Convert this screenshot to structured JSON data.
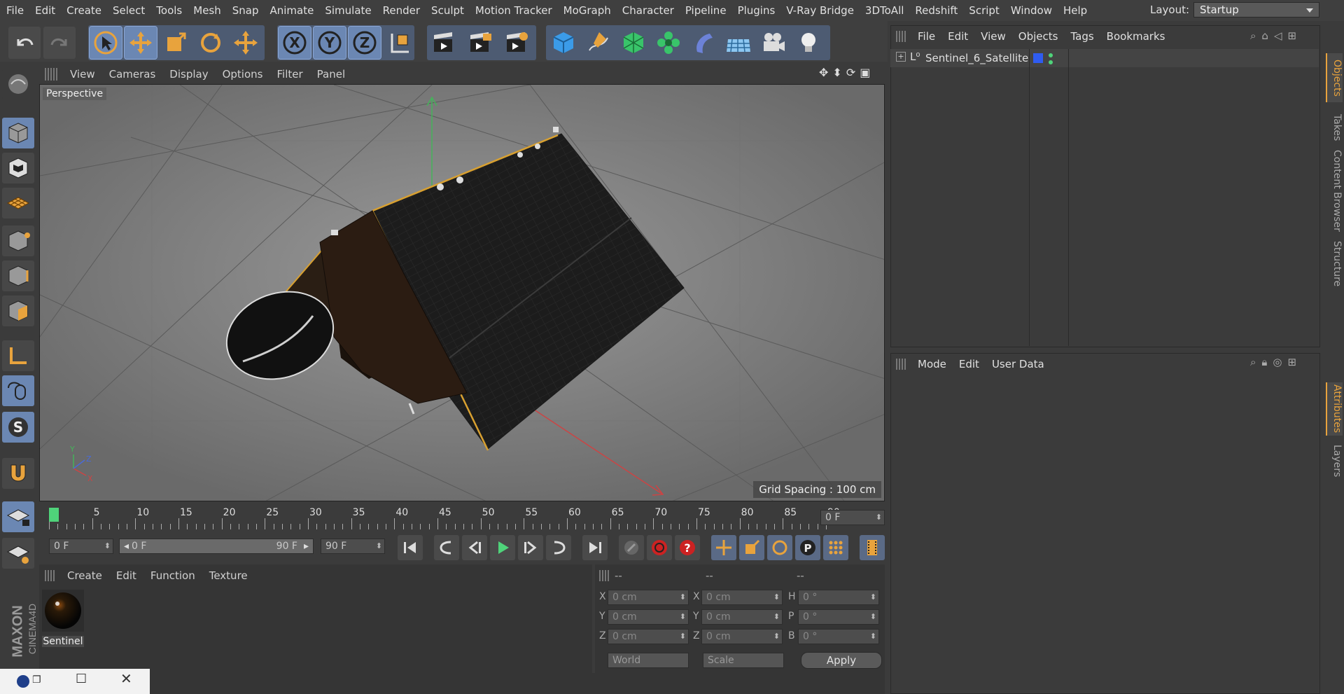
{
  "menu": [
    "File",
    "Edit",
    "Create",
    "Select",
    "Tools",
    "Mesh",
    "Snap",
    "Animate",
    "Simulate",
    "Render",
    "Sculpt",
    "Motion Tracker",
    "MoGraph",
    "Character",
    "Pipeline",
    "Plugins",
    "V-Ray Bridge",
    "3DToAll",
    "Redshift",
    "Script",
    "Window",
    "Help"
  ],
  "layout": {
    "label": "Layout:",
    "value": "Startup"
  },
  "viewport": {
    "menu": [
      "View",
      "Cameras",
      "Display",
      "Options",
      "Filter",
      "Panel"
    ],
    "name": "Perspective",
    "grid_spacing": "Grid Spacing : 100 cm",
    "axis_labels": {
      "x": "X",
      "y": "Y",
      "z": "Z"
    }
  },
  "timeline": {
    "ticks": [
      "0",
      "5",
      "10",
      "15",
      "20",
      "25",
      "30",
      "35",
      "40",
      "45",
      "50",
      "55",
      "60",
      "65",
      "70",
      "75",
      "80",
      "85",
      "90"
    ],
    "current_frame": "0 F",
    "start": "0 F",
    "range_start": "0 F",
    "range_end": "90 F",
    "end": "90 F"
  },
  "material_manager": {
    "menu": [
      "Create",
      "Edit",
      "Function",
      "Texture"
    ],
    "materials": [
      {
        "name": "Sentinel"
      }
    ]
  },
  "coordinates": {
    "headers": [
      "--",
      "--",
      "--"
    ],
    "rows": [
      {
        "a": "X",
        "av": "0 cm",
        "b": "X",
        "bv": "0 cm",
        "c": "H",
        "cv": "0 °"
      },
      {
        "a": "Y",
        "av": "0 cm",
        "b": "Y",
        "bv": "0 cm",
        "c": "P",
        "cv": "0 °"
      },
      {
        "a": "Z",
        "av": "0 cm",
        "b": "Z",
        "bv": "0 cm",
        "c": "B",
        "cv": "0 °"
      }
    ],
    "space": "World",
    "mode": "Scale",
    "apply": "Apply"
  },
  "object_manager": {
    "menu": [
      "File",
      "Edit",
      "View",
      "Objects",
      "Tags",
      "Bookmarks"
    ],
    "objects": [
      {
        "name": "Sentinel_6_Satellite",
        "layer_color": "#2f5cf0"
      }
    ]
  },
  "attributes": {
    "menu": [
      "Mode",
      "Edit",
      "User Data"
    ]
  },
  "side_tabs": [
    "Objects",
    "Takes",
    "Content Browser",
    "Structure",
    "Attributes",
    "Layers"
  ],
  "branding": {
    "line1": "MAXON",
    "line2": "CINEMA4D"
  },
  "colors": {
    "accent": "#e8a33d",
    "selection": "#6b87b3",
    "playhead": "#4fd37a"
  }
}
